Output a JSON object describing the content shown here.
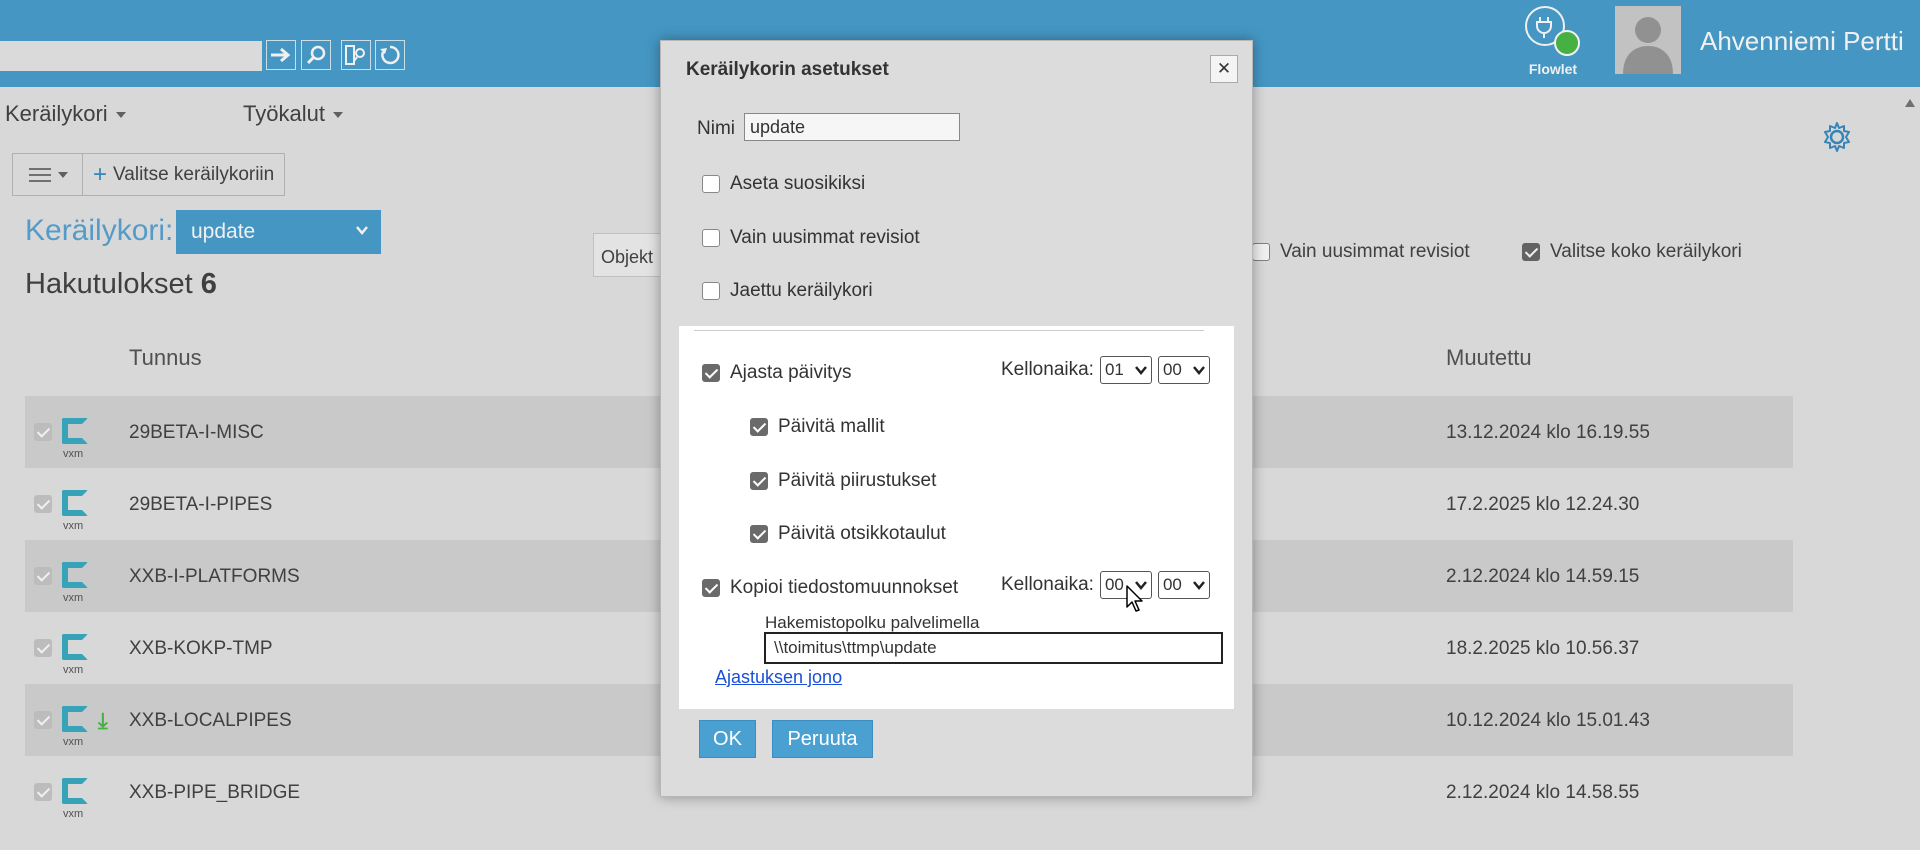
{
  "header": {
    "search_value": "",
    "flowlet_label": "Flowlet",
    "user_name": "Ahvenniemi Pertti",
    "accent_color": "#4aa0d0",
    "status_color": "#4cbb47"
  },
  "menu": {
    "items": [
      {
        "label": "Keräilykori"
      },
      {
        "label": "Työkalut"
      }
    ]
  },
  "toolbar": {
    "add_label": "Valitse keräilykoriin"
  },
  "basket": {
    "label": "Keräilykori:",
    "selected": "update",
    "results_label": "Hakutulokset",
    "results_count": "6"
  },
  "filters": {
    "objekt_label": "Objekt",
    "latest_revisions": {
      "label": "Vain uusimmat revisiot",
      "checked": false
    },
    "select_whole_basket": {
      "label": "Valitse koko keräilykori",
      "checked": true
    }
  },
  "table": {
    "columns": [
      "Tunnus",
      "Muutettu"
    ],
    "rows": [
      {
        "tunnus": "29BETA-I-MISC",
        "muutettu": "13.12.2024 klo 16.19.55",
        "type": "vxm",
        "download": false
      },
      {
        "tunnus": "29BETA-I-PIPES",
        "muutettu": "17.2.2025 klo 12.24.30",
        "type": "vxm",
        "download": false
      },
      {
        "tunnus": "XXB-I-PLATFORMS",
        "muutettu": "2.12.2024 klo 14.59.15",
        "type": "vxm",
        "download": false
      },
      {
        "tunnus": "XXB-KOKP-TMP",
        "muutettu": "18.2.2025 klo 10.56.37",
        "type": "vxm",
        "download": false
      },
      {
        "tunnus": "XXB-LOCALPIPES",
        "muutettu": "10.12.2024 klo 15.01.43",
        "type": "vxm",
        "download": true
      },
      {
        "tunnus": "XXB-PIPE_BRIDGE",
        "muutettu": "2.12.2024 klo 14.58.55",
        "type": "vxm",
        "download": false
      }
    ]
  },
  "dialog": {
    "title": "Keräilykorin asetukset",
    "close_label": "✕",
    "name_label": "Nimi",
    "name_value": "update",
    "set_favorite": {
      "label": "Aseta suosikiksi",
      "checked": false
    },
    "latest_revisions": {
      "label": "Vain uusimmat revisiot",
      "checked": false
    },
    "shared": {
      "label": "Jaettu keräilykori",
      "checked": false
    },
    "schedule_update": {
      "label": "Ajasta päivitys",
      "checked": true
    },
    "time_label": "Kellonaika:",
    "update_hour": "01",
    "update_minute": "00",
    "update_models": {
      "label": "Päivitä mallit",
      "checked": true
    },
    "update_drawings": {
      "label": "Päivitä piirustukset",
      "checked": true
    },
    "update_title_blocks": {
      "label": "Päivitä otsikkotaulut",
      "checked": true
    },
    "copy_changes": {
      "label": "Kopioi tiedostomuunnokset",
      "checked": true
    },
    "copy_hour": "00",
    "copy_minute": "00",
    "path_label": "Hakemistopolku palvelimella",
    "path_value": "\\\\toimitus\\ttmp\\update",
    "queue_link": "Ajastuksen jono",
    "ok_label": "OK",
    "cancel_label": "Peruuta"
  }
}
